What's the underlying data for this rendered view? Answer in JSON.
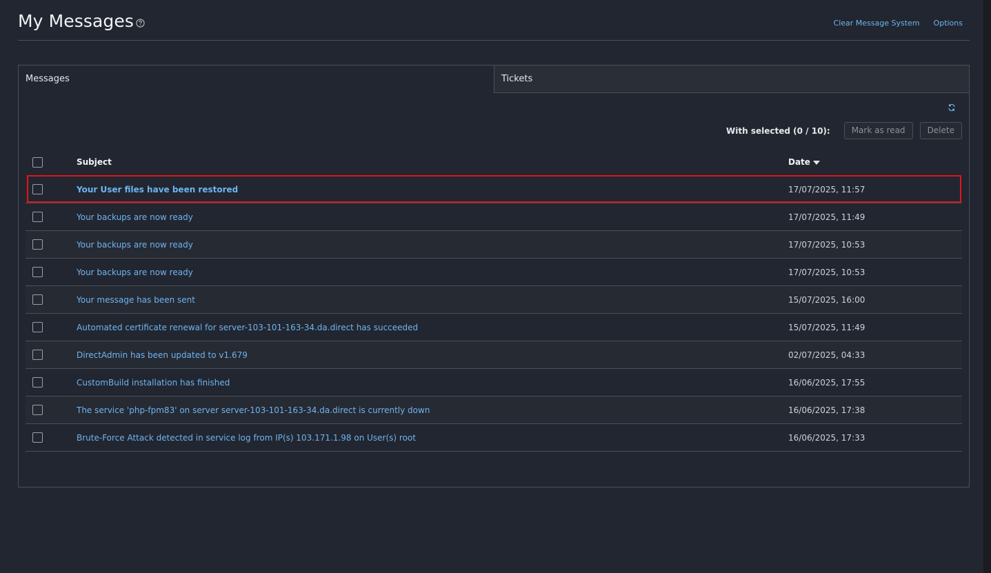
{
  "page": {
    "title": "My Messages",
    "header_links": [
      "Clear Message System",
      "Options"
    ]
  },
  "tabs": [
    {
      "label": "Messages",
      "active": true
    },
    {
      "label": "Tickets",
      "active": false
    }
  ],
  "toolbar": {
    "with_selected": "With selected (0 / 10):",
    "mark_as_read": "Mark as read",
    "delete": "Delete"
  },
  "table": {
    "headers": {
      "subject": "Subject",
      "date": "Date"
    },
    "rows": [
      {
        "subject": "Your User files have been restored",
        "date": "17/07/2025, 11:57"
      },
      {
        "subject": "Your backups are now ready",
        "date": "17/07/2025, 11:49"
      },
      {
        "subject": "Your backups are now ready",
        "date": "17/07/2025, 10:53"
      },
      {
        "subject": "Your backups are now ready",
        "date": "17/07/2025, 10:53"
      },
      {
        "subject": "Your message has been sent",
        "date": "15/07/2025, 16:00"
      },
      {
        "subject": "Automated certificate renewal for server-103-101-163-34.da.direct has succeeded",
        "date": "15/07/2025, 11:49"
      },
      {
        "subject": "DirectAdmin has been updated to v1.679",
        "date": "02/07/2025, 04:33"
      },
      {
        "subject": "CustomBuild installation has finished",
        "date": "16/06/2025, 17:55"
      },
      {
        "subject": "The service 'php-fpm83' on server server-103-101-163-34.da.direct is currently down",
        "date": "16/06/2025, 17:38"
      },
      {
        "subject": "Brute-Force Attack detected in service log from IP(s) 103.171.1.98 on User(s) root",
        "date": "16/06/2025, 17:33"
      }
    ]
  },
  "icons": {
    "help": "help-circle-icon",
    "refresh": "refresh-icon",
    "sort": "sort-down-icon"
  },
  "colors": {
    "link": "#6fb4f0",
    "highlight": "#e0151b",
    "background": "#222630"
  }
}
